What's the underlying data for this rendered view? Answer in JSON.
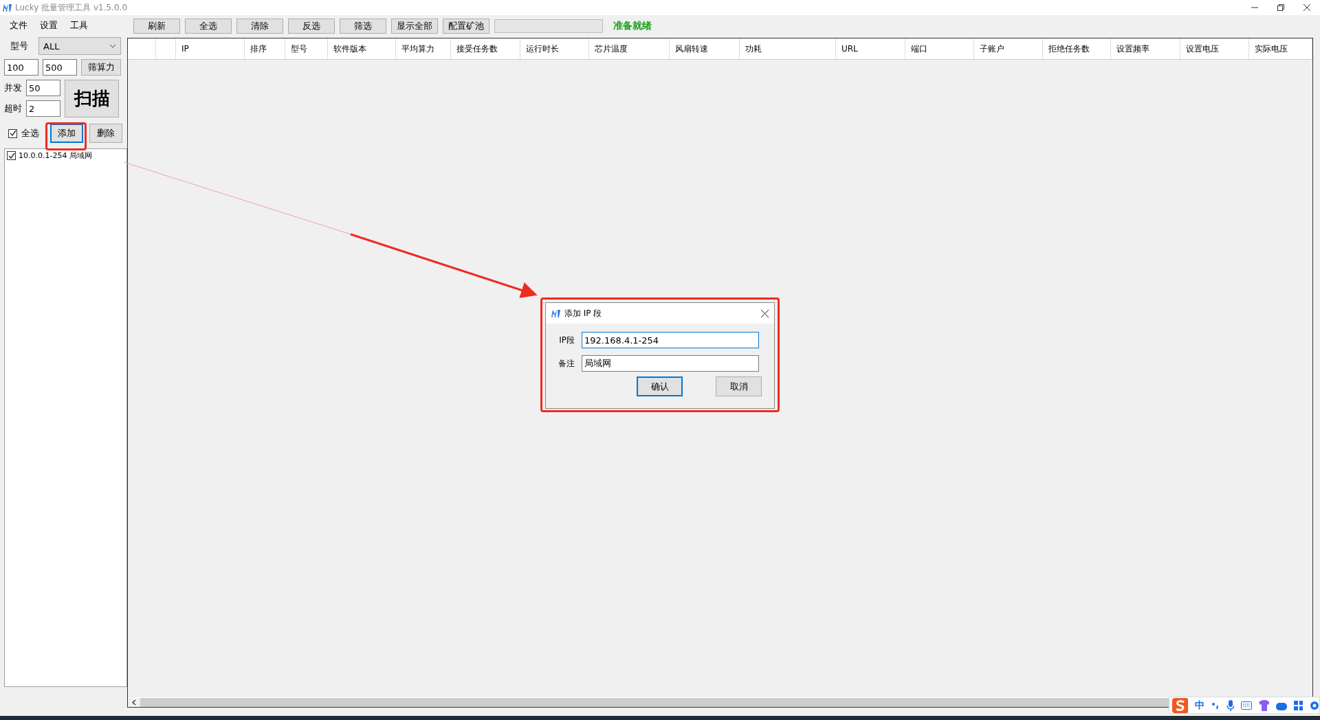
{
  "window": {
    "title": "Lucky 批量管理工具 v1.5.0.0"
  },
  "menu": [
    "文件",
    "设置",
    "工具"
  ],
  "toolbar": {
    "buttons": [
      "刷新",
      "全选",
      "清除",
      "反选",
      "筛选",
      "显示全部",
      "配置矿池"
    ],
    "progress": {
      "level": 0
    },
    "status": "准备就绪"
  },
  "sidebar": {
    "model_label": "型号",
    "model_value": "ALL",
    "min_hashrate": "100",
    "max_hashrate": "500",
    "filter_button": "筛算力",
    "concurrency_label": "并发",
    "concurrency": "50",
    "timeout_label": "超时",
    "timeout": "2",
    "scan_button": "扫描",
    "select_all": {
      "label": "全选",
      "checked": true
    },
    "add_button": "添加",
    "delete_button": "删除",
    "ranges": [
      {
        "label": "10.0.0.1-254 局域网",
        "checked": true
      }
    ]
  },
  "table": {
    "columns": [
      "IP",
      "排序",
      "型号",
      "软件版本",
      "平均算力",
      "接受任务数",
      "运行时长",
      "芯片温度",
      "风扇转速",
      "功耗",
      "URL",
      "端口",
      "子账户",
      "拒绝任务数",
      "设置频率",
      "设置电压",
      "实际电压"
    ]
  },
  "dialog": {
    "title": "添加 IP 段",
    "fields": [
      {
        "label": "IP段",
        "value": "192.168.4.1-254",
        "focused": true
      },
      {
        "label": "备注",
        "value": "局域网",
        "focused": false
      }
    ],
    "buttons": [
      {
        "label": "确认",
        "default": true
      },
      {
        "label": "取消",
        "default": false
      }
    ]
  },
  "ime_bar": {
    "mode": "中"
  }
}
